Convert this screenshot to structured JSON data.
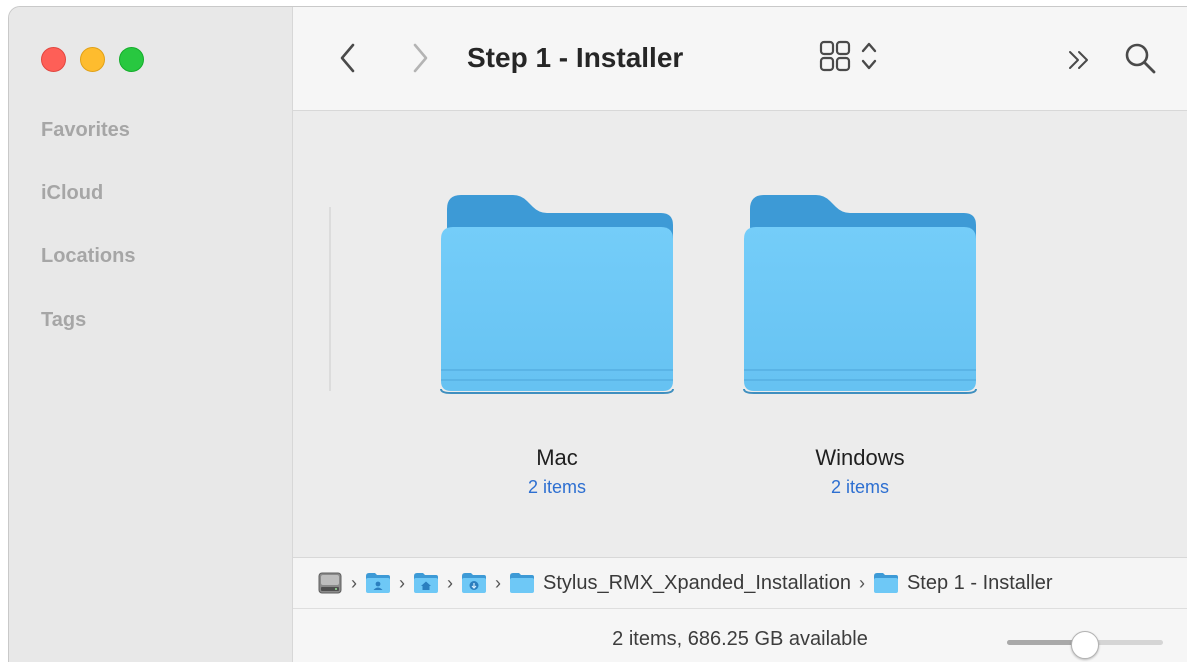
{
  "window": {
    "title": "Step 1 - Installer"
  },
  "sidebar": {
    "sections": [
      {
        "label": "Favorites"
      },
      {
        "label": "iCloud"
      },
      {
        "label": "Locations"
      },
      {
        "label": "Tags"
      }
    ]
  },
  "toolbar": {
    "back_icon": "chevron-left-icon",
    "forward_icon": "chevron-right-icon",
    "view_icon": "icon-grid-view-icon",
    "more_icon": "double-chevron-right-icon",
    "search_icon": "search-icon"
  },
  "content": {
    "items": [
      {
        "name": "Mac",
        "count": "2 items",
        "icon": "folder-icon"
      },
      {
        "name": "Windows",
        "count": "2 items",
        "icon": "folder-icon"
      }
    ]
  },
  "pathbar": {
    "crumbs": [
      {
        "label": "",
        "icon": "hard-drive-icon"
      },
      {
        "label": "",
        "icon": "user-folder-icon"
      },
      {
        "label": "",
        "icon": "home-folder-icon"
      },
      {
        "label": "",
        "icon": "downloads-folder-icon"
      },
      {
        "label": "Stylus_RMX_Xpanded_Installation",
        "icon": "folder-icon"
      },
      {
        "label": "Step 1 - Installer",
        "icon": "folder-icon"
      }
    ]
  },
  "statusbar": {
    "text": "2 items, 686.25 GB available",
    "zoom_level": 0.5
  },
  "colors": {
    "folder_front": "#6ec8f6",
    "folder_back": "#3a9ad8",
    "count_text": "#2d6fd1",
    "close": "#fe5f57",
    "minimize": "#febc2e",
    "maximize": "#28c840"
  }
}
